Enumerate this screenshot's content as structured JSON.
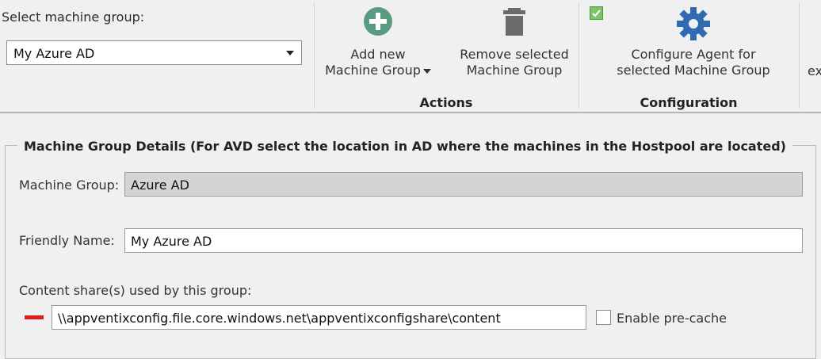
{
  "ribbon": {
    "select_label": "Select machine group:",
    "selected_group": "My Azure AD",
    "add_button": {
      "line1": "Add new",
      "line2": "Machine Group"
    },
    "remove_button": {
      "line1": "Remove selected",
      "line2": "Machine Group"
    },
    "configure_button": {
      "line1": "Configure Agent for",
      "line2": "selected Machine Group"
    },
    "actions_group_title": "Actions",
    "configuration_group_title": "Configuration",
    "cut_off_text": "ex",
    "icons": {
      "add": "plus-circle-icon",
      "remove": "trash-icon",
      "configure": "gear-icon",
      "status": "check-icon"
    }
  },
  "colors": {
    "add_icon": "#5a9a80",
    "remove_icon": "#6b6b6b",
    "configure_icon": "#2f6bb0",
    "remove_share": "#e41b1b"
  },
  "details": {
    "legend": "Machine Group Details (For AVD select the location in AD where the machines in the Hostpool are located)",
    "machine_group_label": "Machine Group:",
    "machine_group_value": "Azure AD",
    "friendly_name_label": "Friendly Name:",
    "friendly_name_value": "My Azure AD",
    "content_share_label": "Content share(s) used by this group:",
    "content_share_value": "\\\\appventixconfig.file.core.windows.net\\appventixconfigshare\\content",
    "precache_label": "Enable pre-cache",
    "precache_checked": false
  }
}
